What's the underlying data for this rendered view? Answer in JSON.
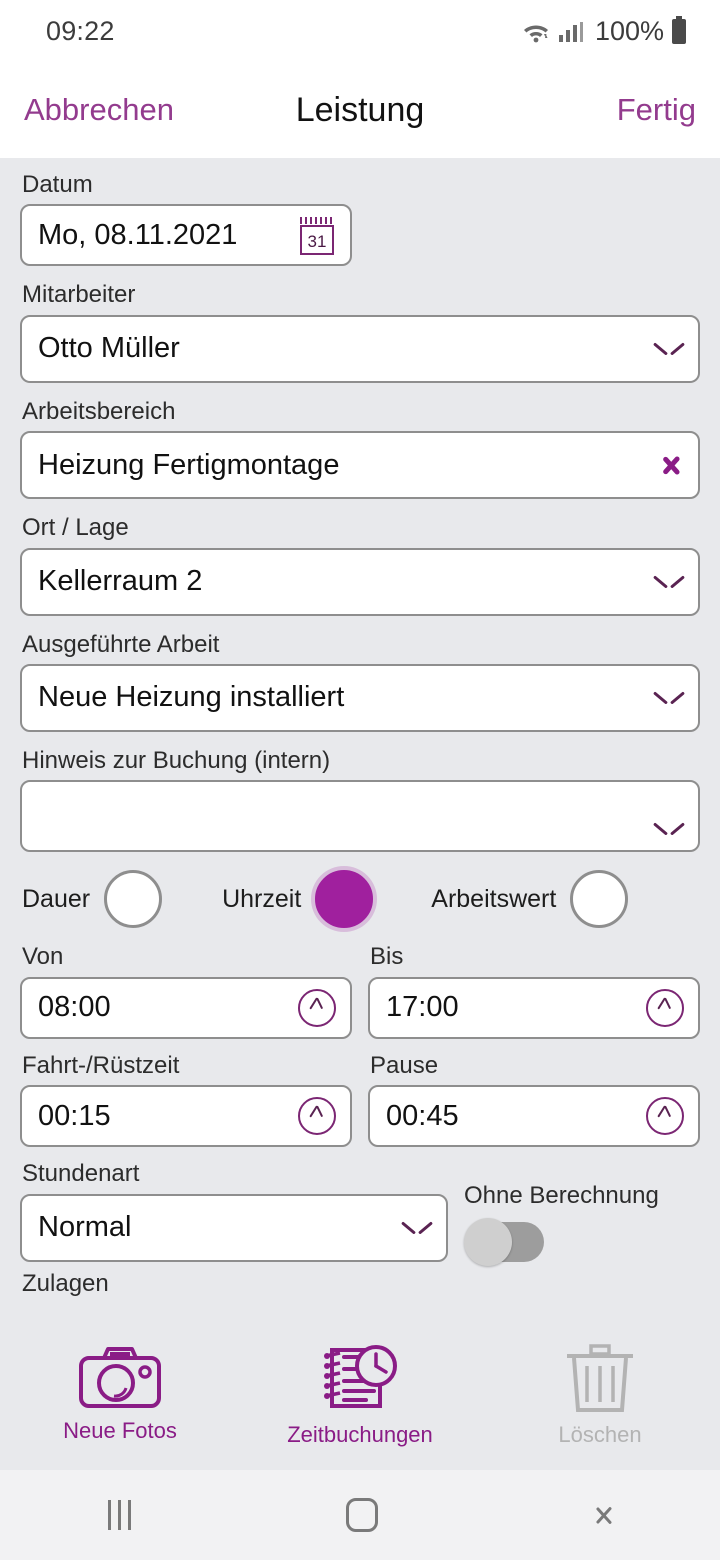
{
  "status_bar": {
    "time": "09:22",
    "battery_percent": "100%",
    "icons": [
      "wifi-icon",
      "signal-icon",
      "battery-icon"
    ]
  },
  "header": {
    "cancel_label": "Abbrechen",
    "title": "Leistung",
    "done_label": "Fertig"
  },
  "colors": {
    "accent": "#8A1C86",
    "accent_link": "#933B8E",
    "radio_selected": "#A0209E",
    "page_background": "#E8E9EC",
    "field_background": "#FFFFFF",
    "field_border": "#8E8E8E",
    "disabled": "#B3B3B3"
  },
  "form": {
    "date": {
      "label": "Datum",
      "value": "Mo, 08.11.2021",
      "icon": "calendar-icon",
      "calendar_day": "31"
    },
    "employee": {
      "label": "Mitarbeiter",
      "value": "Otto Müller",
      "icon": "chevron-down-icon"
    },
    "work_area": {
      "label": "Arbeitsbereich",
      "value": "Heizung Fertigmontage",
      "icon": "chevron-right-icon"
    },
    "location": {
      "label": "Ort / Lage",
      "value": "Kellerraum 2",
      "icon": "chevron-down-icon"
    },
    "performed_work": {
      "label": "Ausgeführte Arbeit",
      "value": "Neue Heizung installiert",
      "icon": "chevron-down-icon"
    },
    "internal_note": {
      "label": "Hinweis zur Buchung (intern)",
      "value": "",
      "placeholder": "",
      "icon": "chevron-down-icon"
    },
    "mode_options": [
      {
        "label": "Dauer",
        "selected": false
      },
      {
        "label": "Uhrzeit",
        "selected": true
      },
      {
        "label": "Arbeitswert",
        "selected": false
      }
    ],
    "from_time": {
      "label": "Von",
      "value": "08:00",
      "icon": "clock-icon"
    },
    "to_time": {
      "label": "Bis",
      "value": "17:00",
      "icon": "clock-icon"
    },
    "travel_setup_time": {
      "label": "Fahrt-/Rüstzeit",
      "value": "00:15",
      "icon": "clock-icon"
    },
    "break_time": {
      "label": "Pause",
      "value": "00:45",
      "icon": "clock-icon"
    },
    "hour_type": {
      "label": "Stundenart",
      "value": "Normal",
      "icon": "chevron-down-icon"
    },
    "no_charge": {
      "label": "Ohne Berechnung",
      "enabled": false
    },
    "surcharges": {
      "label": "Zulagen"
    }
  },
  "toolbar": [
    {
      "label": "Neue Fotos",
      "icon": "camera-icon",
      "disabled": false
    },
    {
      "label": "Zeitbuchungen",
      "icon": "timesheet-clock-icon",
      "disabled": false
    },
    {
      "label": "Löschen",
      "icon": "trash-icon",
      "disabled": true
    }
  ],
  "nav_bar": {
    "recents": "recents-icon",
    "home": "home-icon",
    "back": "back-icon"
  }
}
